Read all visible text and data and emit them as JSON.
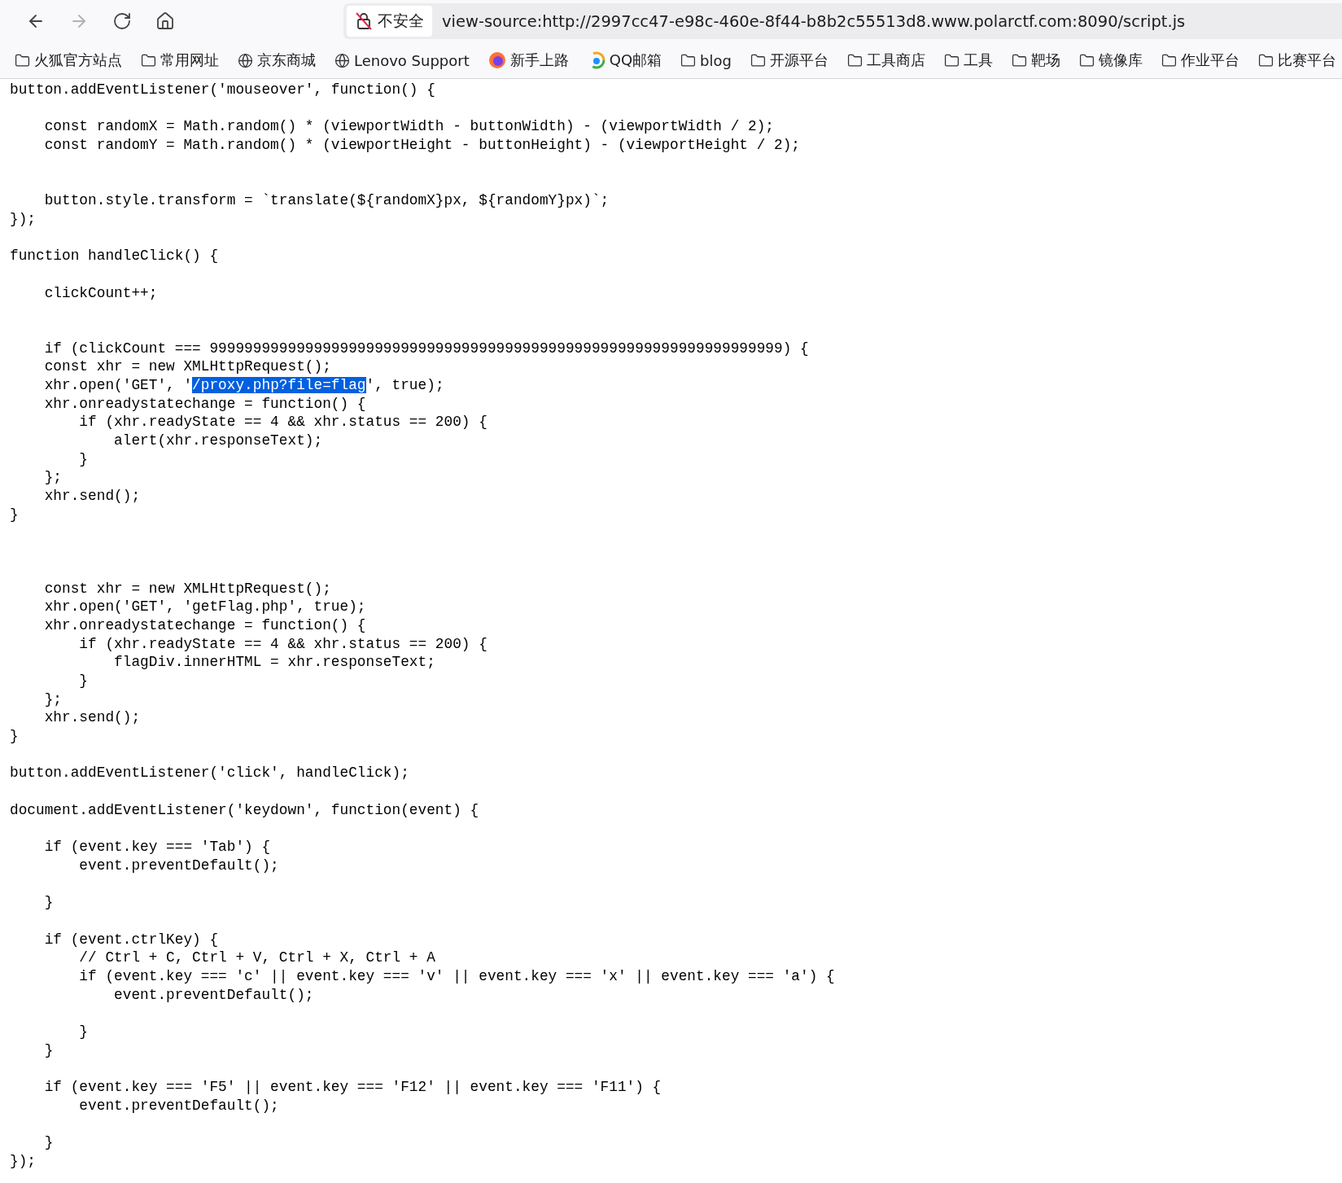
{
  "toolbar": {
    "buttons": [
      {
        "kind": "back",
        "disabled": false
      },
      {
        "kind": "forward",
        "disabled": true
      },
      {
        "kind": "reload",
        "disabled": false
      },
      {
        "kind": "home",
        "disabled": false
      }
    ],
    "address_bar": {
      "security_label": "不安全",
      "url": "view-source:http://2997cc47-e98c-460e-8f44-b8b2c55513d8.www.polarctf.com:8090/script.js"
    }
  },
  "bookmarks": [
    {
      "kind": "folder",
      "label": "火狐官方站点"
    },
    {
      "kind": "folder",
      "label": "常用网址"
    },
    {
      "kind": "globe",
      "label": "京东商城"
    },
    {
      "kind": "globe",
      "label": "Lenovo Support"
    },
    {
      "kind": "firefox",
      "label": "新手上路"
    },
    {
      "kind": "qq",
      "label": "QQ邮箱"
    },
    {
      "kind": "folder",
      "label": "blog"
    },
    {
      "kind": "folder",
      "label": "开源平台"
    },
    {
      "kind": "folder",
      "label": "工具商店"
    },
    {
      "kind": "folder",
      "label": "工具"
    },
    {
      "kind": "folder",
      "label": "靶场"
    },
    {
      "kind": "folder",
      "label": "镜像库"
    },
    {
      "kind": "folder",
      "label": "作业平台"
    },
    {
      "kind": "folder",
      "label": "比赛平台"
    }
  ],
  "source": {
    "lines": [
      {
        "kind": "code",
        "text": "button.addEventListener('mouseover', function() {"
      },
      {
        "kind": "blank"
      },
      {
        "kind": "code",
        "text": "    const randomX = Math.random() * (viewportWidth - buttonWidth) - (viewportWidth / 2);"
      },
      {
        "kind": "code",
        "text": "    const randomY = Math.random() * (viewportHeight - buttonHeight) - (viewportHeight / 2);"
      },
      {
        "kind": "blank"
      },
      {
        "kind": "blank"
      },
      {
        "kind": "code",
        "text": "    button.style.transform = `translate(${randomX}px, ${randomY}px)`;"
      },
      {
        "kind": "code",
        "text": "});"
      },
      {
        "kind": "blank"
      },
      {
        "kind": "code",
        "text": "function handleClick() {"
      },
      {
        "kind": "blank"
      },
      {
        "kind": "code",
        "text": "    clickCount++;"
      },
      {
        "kind": "blank"
      },
      {
        "kind": "blank"
      },
      {
        "kind": "code",
        "text": "    if (clickCount === 999999999999999999999999999999999999999999999999999999999999999999) {"
      },
      {
        "kind": "code",
        "text": "    const xhr = new XMLHttpRequest();"
      },
      {
        "kind": "segments",
        "segments": [
          {
            "text": "    xhr.open('GET', '",
            "selected": false
          },
          {
            "text": "/proxy.php?file=flag",
            "selected": true
          },
          {
            "text": "', true);",
            "selected": false
          }
        ]
      },
      {
        "kind": "code",
        "text": "    xhr.onreadystatechange = function() {"
      },
      {
        "kind": "code",
        "text": "        if (xhr.readyState == 4 && xhr.status == 200) {"
      },
      {
        "kind": "code",
        "text": "            alert(xhr.responseText);"
      },
      {
        "kind": "code",
        "text": "        }"
      },
      {
        "kind": "code",
        "text": "    };"
      },
      {
        "kind": "code",
        "text": "    xhr.send();"
      },
      {
        "kind": "code",
        "text": "}"
      },
      {
        "kind": "blank"
      },
      {
        "kind": "blank"
      },
      {
        "kind": "blank"
      },
      {
        "kind": "code",
        "text": "    const xhr = new XMLHttpRequest();"
      },
      {
        "kind": "code",
        "text": "    xhr.open('GET', 'getFlag.php', true);"
      },
      {
        "kind": "code",
        "text": "    xhr.onreadystatechange = function() {"
      },
      {
        "kind": "code",
        "text": "        if (xhr.readyState == 4 && xhr.status == 200) {"
      },
      {
        "kind": "code",
        "text": "            flagDiv.innerHTML = xhr.responseText;"
      },
      {
        "kind": "code",
        "text": "        }"
      },
      {
        "kind": "code",
        "text": "    };"
      },
      {
        "kind": "code",
        "text": "    xhr.send();"
      },
      {
        "kind": "code",
        "text": "}"
      },
      {
        "kind": "blank"
      },
      {
        "kind": "code",
        "text": "button.addEventListener('click', handleClick);"
      },
      {
        "kind": "blank"
      },
      {
        "kind": "code",
        "text": "document.addEventListener('keydown', function(event) {"
      },
      {
        "kind": "blank"
      },
      {
        "kind": "code",
        "text": "    if (event.key === 'Tab') {"
      },
      {
        "kind": "code",
        "text": "        event.preventDefault();"
      },
      {
        "kind": "blank"
      },
      {
        "kind": "code",
        "text": "    }"
      },
      {
        "kind": "blank"
      },
      {
        "kind": "code",
        "text": "    if (event.ctrlKey) {"
      },
      {
        "kind": "code",
        "text": "        // Ctrl + C, Ctrl + V, Ctrl + X, Ctrl + A"
      },
      {
        "kind": "code",
        "text": "        if (event.key === 'c' || event.key === 'v' || event.key === 'x' || event.key === 'a') {"
      },
      {
        "kind": "code",
        "text": "            event.preventDefault();"
      },
      {
        "kind": "blank"
      },
      {
        "kind": "code",
        "text": "        }"
      },
      {
        "kind": "code",
        "text": "    }"
      },
      {
        "kind": "blank"
      },
      {
        "kind": "code",
        "text": "    if (event.key === 'F5' || event.key === 'F12' || event.key === 'F11') {"
      },
      {
        "kind": "code",
        "text": "        event.preventDefault();"
      },
      {
        "kind": "blank"
      },
      {
        "kind": "code",
        "text": "    }"
      },
      {
        "kind": "code",
        "text": "});"
      }
    ]
  }
}
